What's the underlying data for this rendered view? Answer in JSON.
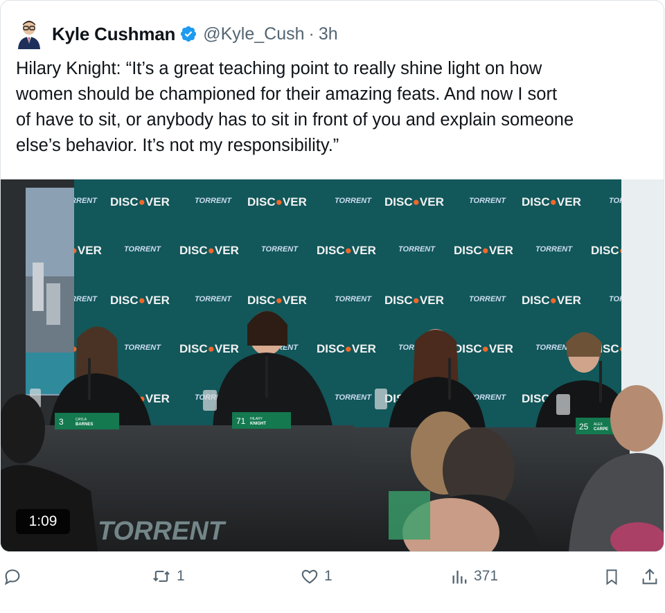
{
  "tweet": {
    "author_name": "Kyle Cushman",
    "handle": "@Kyle_Cush",
    "separator": "·",
    "time": "3h",
    "lines": [
      "Hilary Knight: “It’s a great teaching point to really shine light on how",
      "women should be championed for their amazing feats. And now I sort",
      "of have to sit, or anybody has to sit in front of you and explain someone",
      "else’s behavior. It’s not my responsibility.”"
    ]
  },
  "media": {
    "duration": "1:09",
    "backdrop_words": [
      "DISCOVER",
      "TORRENT"
    ],
    "nameplates": [
      {
        "number": "3",
        "first": "CAYLA",
        "last": "BARNES"
      },
      {
        "number": "71",
        "first": "HILARY",
        "last": "KNIGHT"
      },
      {
        "number": "25",
        "first": "ALEX",
        "last": "CARPE"
      }
    ],
    "table_logo": "TORRENT"
  },
  "actions": {
    "reply_count": "",
    "retweet_count": "1",
    "like_count": "1",
    "views_count": "371"
  },
  "colors": {
    "accent": "#1d9bf0",
    "muted": "#536471",
    "backdrop": "#12575a"
  }
}
